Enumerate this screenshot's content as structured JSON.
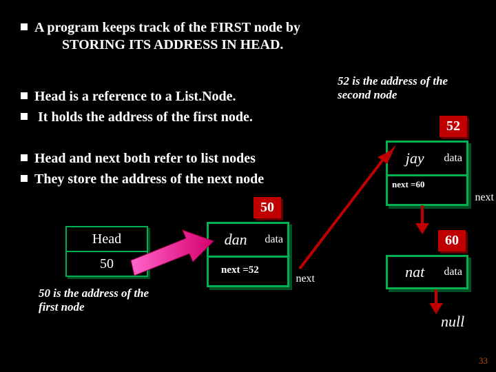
{
  "bullets": {
    "b1_line1": "A program keeps track of the FIRST node by",
    "b1_line2": "STORING  ITS  ADDRESS  IN  HEAD.",
    "b2": "Head is a reference to a List.Node.",
    "b3": " It holds the address of the first node.",
    "b4": "Head and next  both refer to list nodes",
    "b5": "They  store the address of the next node"
  },
  "annotations": {
    "second_node_l1": "52 is the address of the",
    "second_node_l2": "second  node",
    "first_node_l1": "50 is the address of the",
    "first_node_l2": "first node"
  },
  "addresses": {
    "node50": "50",
    "node52": "52",
    "node60": "60"
  },
  "head_box": {
    "title": "Head",
    "value": "50"
  },
  "node50": {
    "data_value": "dan",
    "data_label": "data",
    "next_value": "next =52",
    "next_label": "next"
  },
  "node52": {
    "data_value": "jay",
    "data_label": "data",
    "next_value": "next =60",
    "next_label": "next"
  },
  "node60": {
    "data_value": "nat",
    "data_label": "data"
  },
  "null_label": "null",
  "page_number": "33"
}
